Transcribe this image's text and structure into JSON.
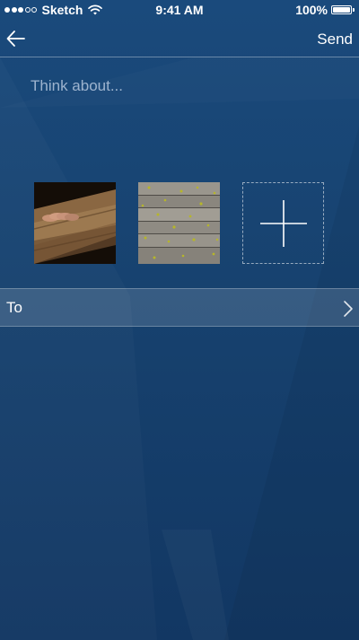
{
  "status_bar": {
    "signal_bars_filled": 3,
    "signal_bars_total": 5,
    "carrier": "Sketch",
    "time": "9:41 AM",
    "battery_percent": "100%",
    "battery_level": 1.0
  },
  "nav": {
    "back_icon": "arrow-left-icon",
    "send_label": "Send"
  },
  "compose": {
    "placeholder": "Think about...",
    "value": ""
  },
  "attachments": [
    {
      "name": "photo-wood-plank"
    },
    {
      "name": "photo-wooden-deck"
    }
  ],
  "add_attachment_icon": "plus-icon",
  "recipient_row": {
    "label": "To",
    "chevron_icon": "chevron-right-icon"
  },
  "colors": {
    "background_top": "#1a4a7c",
    "background_bottom": "#123763",
    "text": "#ffffff"
  }
}
